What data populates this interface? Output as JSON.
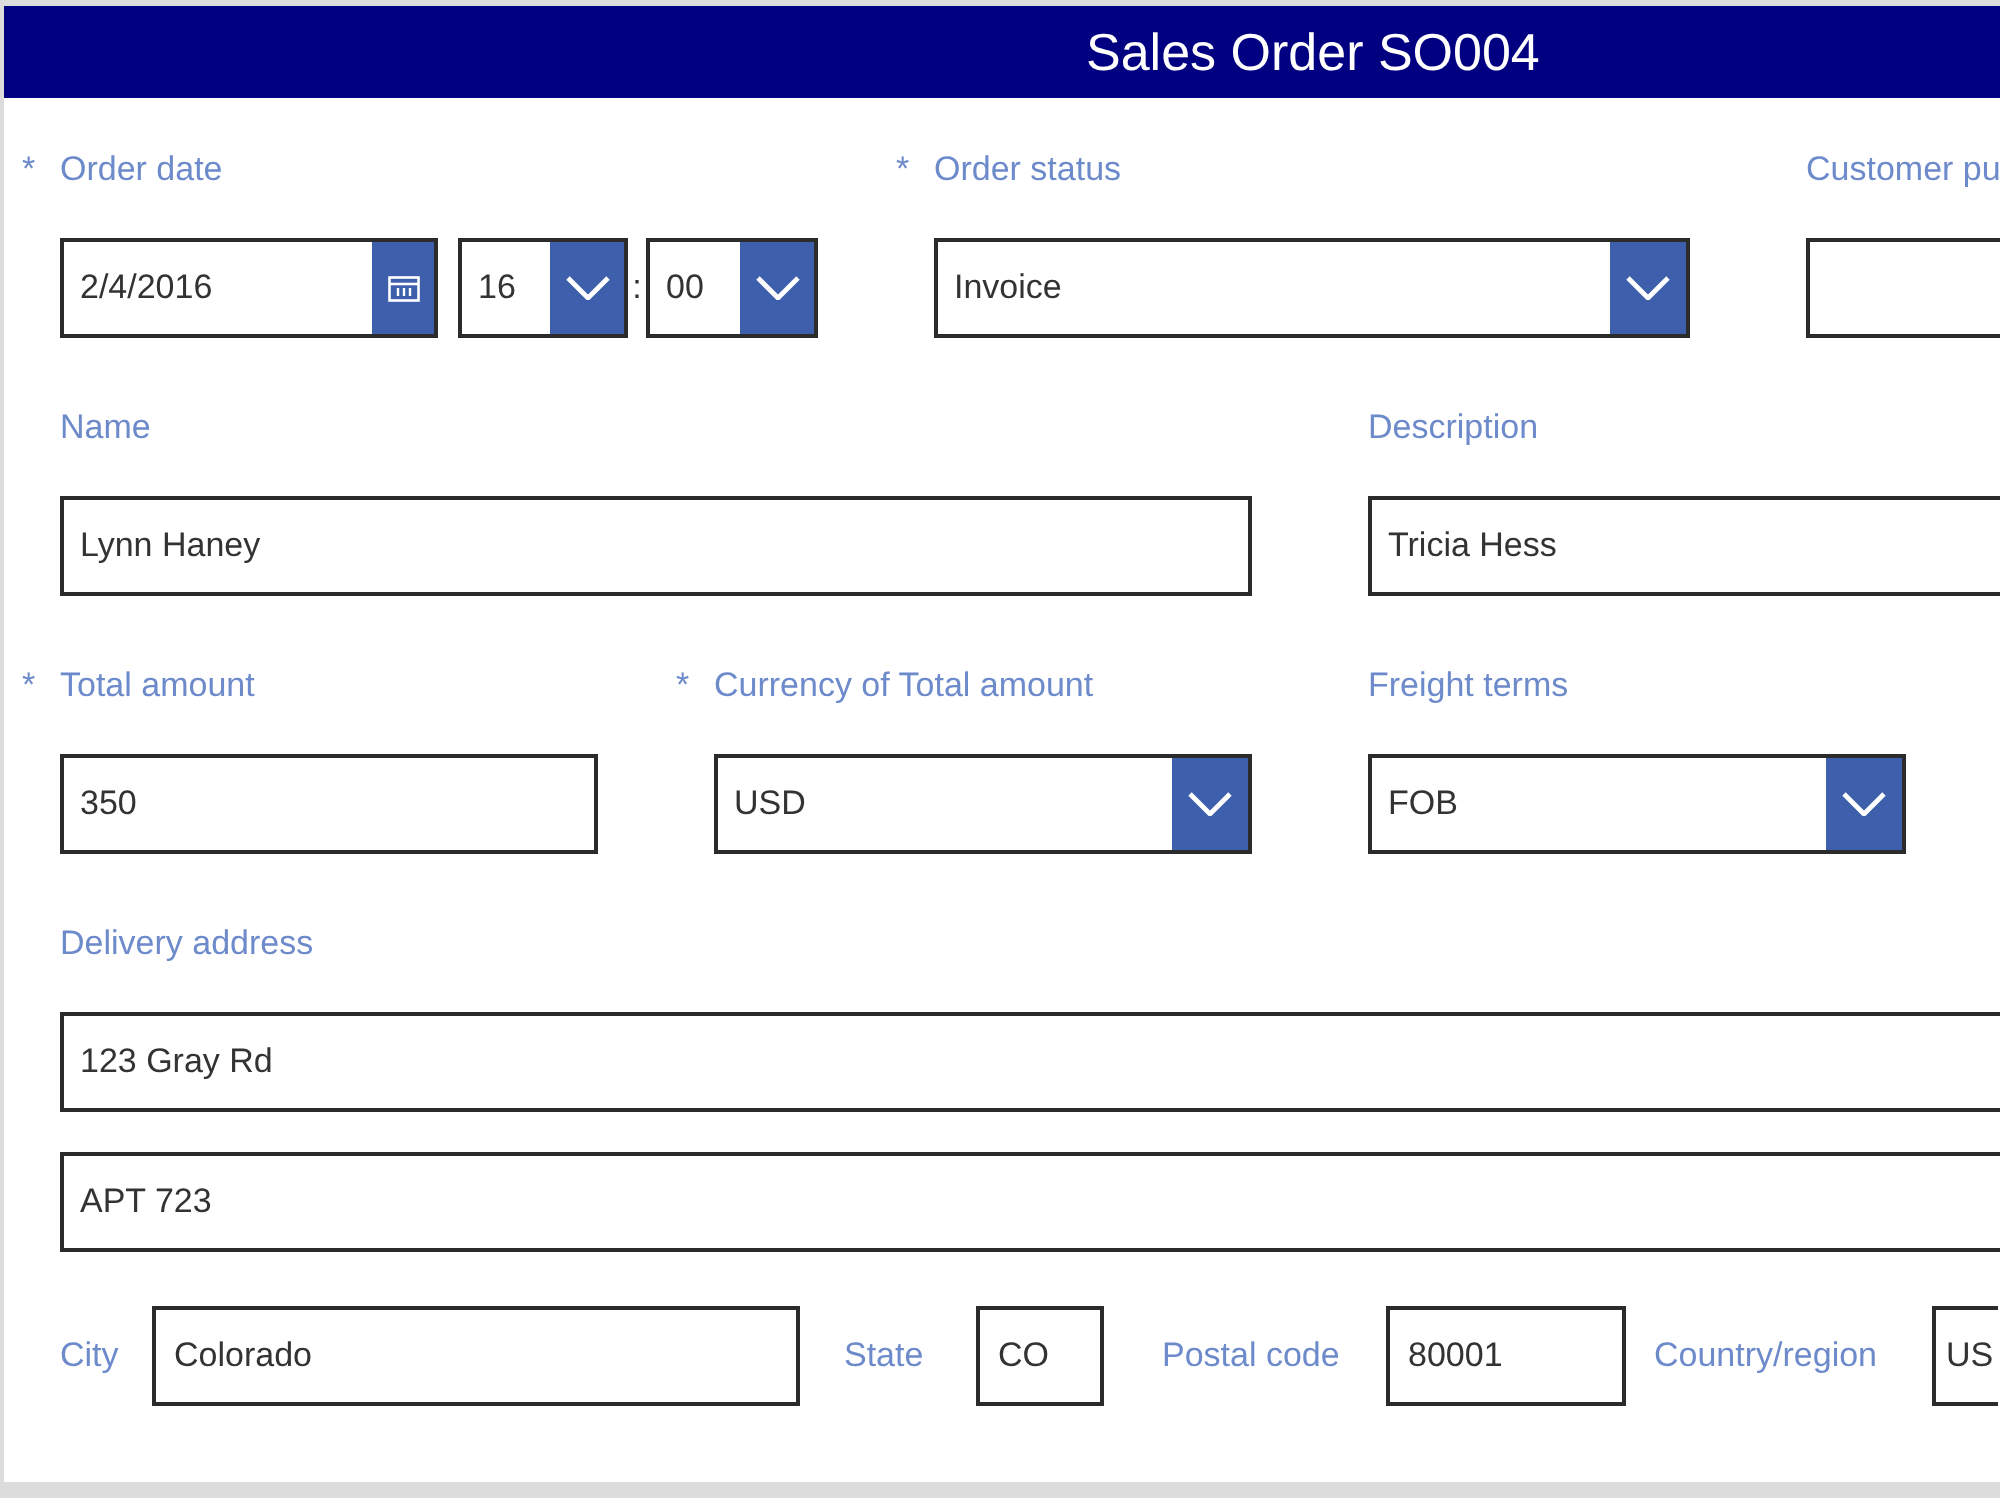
{
  "header": {
    "title": "Sales Order SO004"
  },
  "rows": [
    {
      "fields": [
        {
          "kind": "datetime",
          "required_mark": "*",
          "label": "Order date",
          "date": "2/4/2016",
          "hour": "16",
          "separator": ":",
          "minute": "00"
        },
        {
          "kind": "dropdown",
          "required_mark": "*",
          "label": "Order status",
          "value": "Invoice"
        },
        {
          "kind": "text",
          "label": "Customer pu"
        }
      ]
    },
    {
      "fields": [
        {
          "kind": "text",
          "label": "Name",
          "value": "Lynn Haney"
        },
        {
          "kind": "text",
          "label": "Description",
          "value": "Tricia Hess"
        }
      ]
    },
    {
      "fields": [
        {
          "kind": "text",
          "required_mark": "*",
          "label": "Total amount",
          "value": "350"
        },
        {
          "kind": "dropdown",
          "required_mark": "*",
          "label": "Currency of Total amount",
          "value": "USD"
        },
        {
          "kind": "dropdown",
          "label": "Freight terms",
          "value": "FOB"
        }
      ]
    }
  ],
  "delivery_address": {
    "label": "Delivery address",
    "lines": [
      "123 Gray Rd",
      "APT 723"
    ]
  },
  "address_fields": [
    {
      "label": "City",
      "value": "Colorado"
    },
    {
      "label": "State",
      "value": "CO"
    },
    {
      "label": "Postal code",
      "value": "80001"
    },
    {
      "label": "Country/region",
      "value": "US"
    }
  ]
}
